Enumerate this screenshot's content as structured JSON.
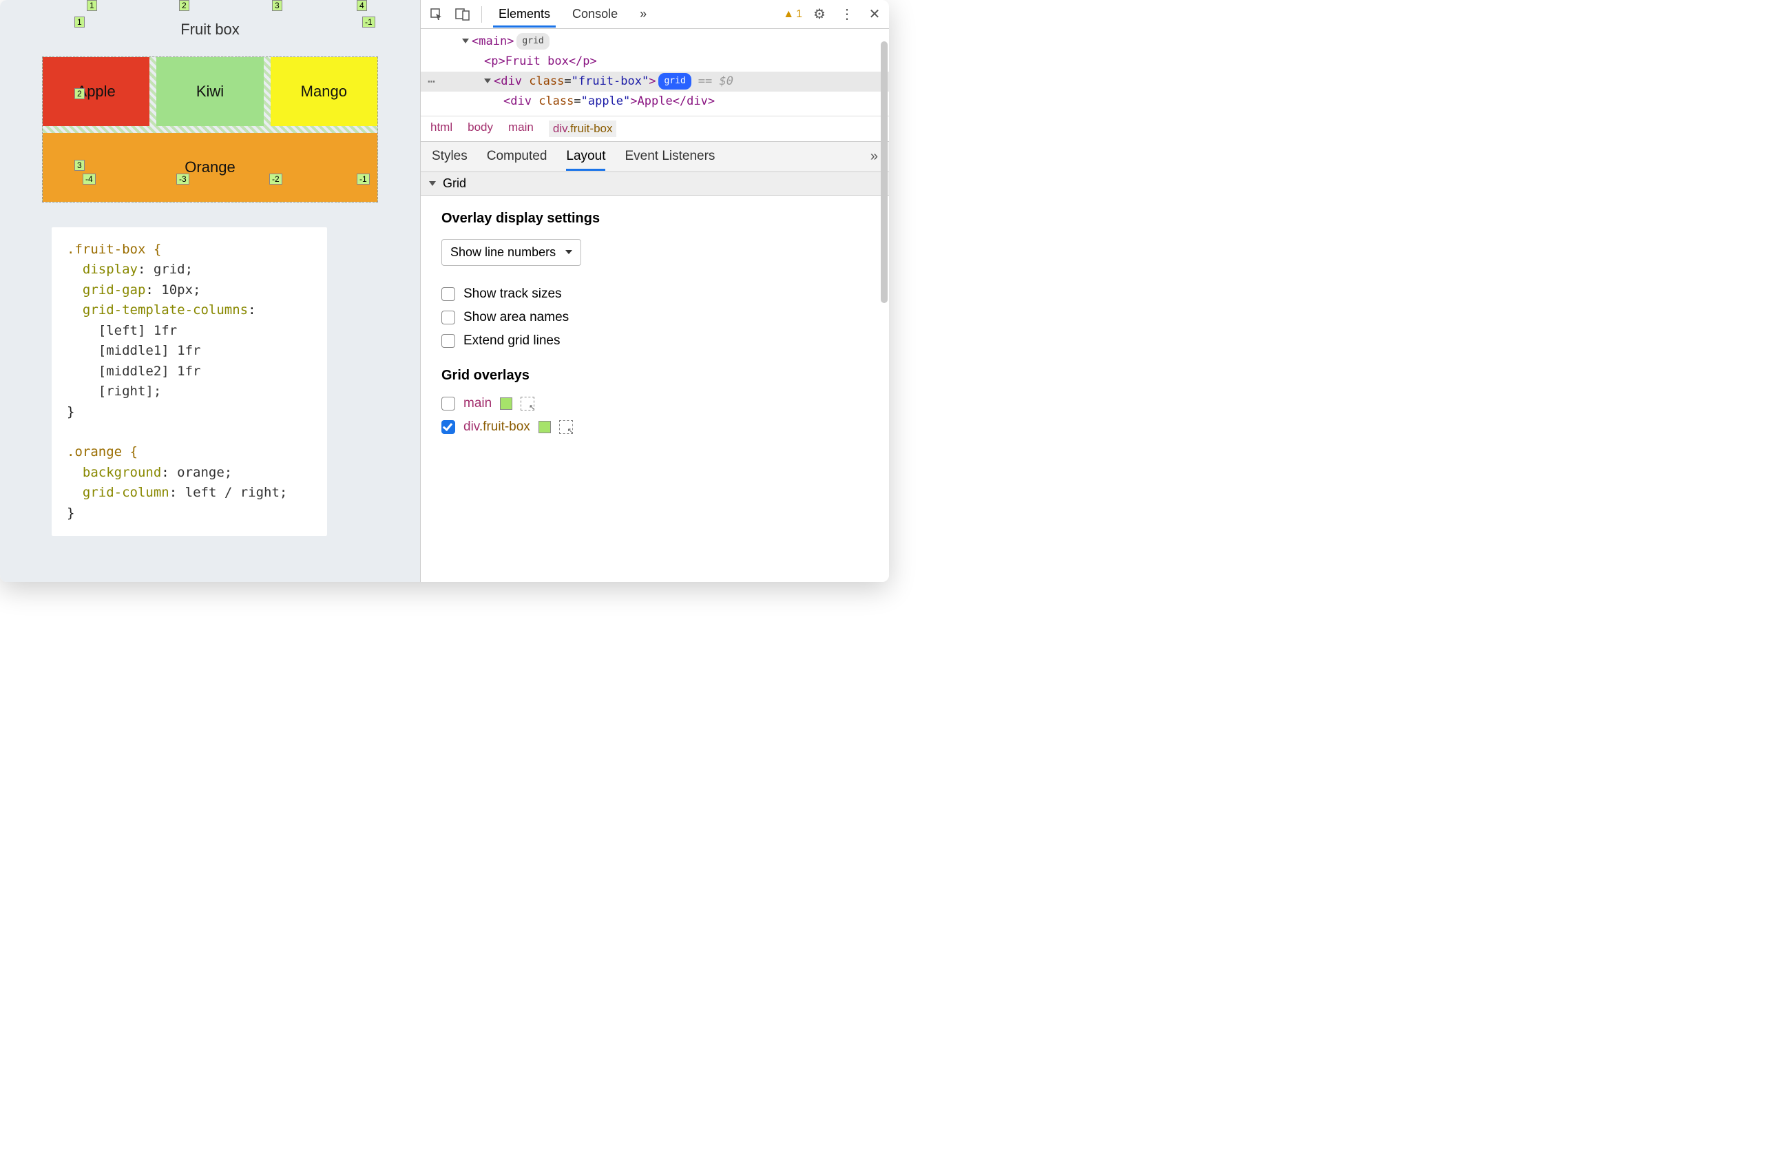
{
  "preview": {
    "title": "Fruit box",
    "cells": {
      "apple": "Apple",
      "kiwi": "Kiwi",
      "mango": "Mango",
      "orange": "Orange"
    },
    "line_badges": {
      "top": [
        "1",
        "2",
        "3",
        "4"
      ],
      "left": [
        "1",
        "2",
        "3"
      ],
      "bottom": [
        "-4",
        "-3",
        "-2",
        "-1"
      ],
      "right_top": "-1"
    },
    "code": {
      "rule1_selector": ".fruit-box {",
      "decl1": "display",
      "decl1v": "grid;",
      "decl2": "grid-gap",
      "decl2v": "10px;",
      "decl3": "grid-template-columns",
      "line_left": "[left] 1fr",
      "line_m1": "[middle1] 1fr",
      "line_m2": "[middle2] 1fr",
      "line_right": "[right];",
      "close1": "}",
      "rule2_selector": ".orange {",
      "decl4": "background",
      "decl4v": "orange;",
      "decl5": "grid-column",
      "decl5v": "left / right;",
      "close2": "}"
    }
  },
  "devtools": {
    "tabs": {
      "elements": "Elements",
      "console": "Console",
      "more": "»"
    },
    "warning_count": "1",
    "dom": {
      "main_open": "<main>",
      "main_badge": "grid",
      "p_line": "<p>Fruit box</p>",
      "div_open_1": "<div ",
      "div_attr": "class",
      "div_val": "\"fruit-box\"",
      "div_open_2": ">",
      "div_badge": "grid",
      "eq_dollar": "== $0",
      "apple_open_1": "<div ",
      "apple_attr": "class",
      "apple_val": "\"apple\"",
      "apple_open_2": ">Apple</div>"
    },
    "crumbs": {
      "c1": "html",
      "c2": "body",
      "c3": "main",
      "c4a": "div",
      "c4b": ".fruit-box"
    },
    "subtabs": {
      "styles": "Styles",
      "computed": "Computed",
      "layout": "Layout",
      "events": "Event Listeners",
      "more": "»"
    },
    "grid_section": {
      "header": "Grid",
      "settings_title": "Overlay display settings",
      "select_value": "Show line numbers",
      "opt_track": "Show track sizes",
      "opt_area": "Show area names",
      "opt_extend": "Extend grid lines",
      "overlays_title": "Grid overlays",
      "ovl1": "main",
      "ovl2a": "div",
      "ovl2b": ".fruit-box"
    }
  }
}
